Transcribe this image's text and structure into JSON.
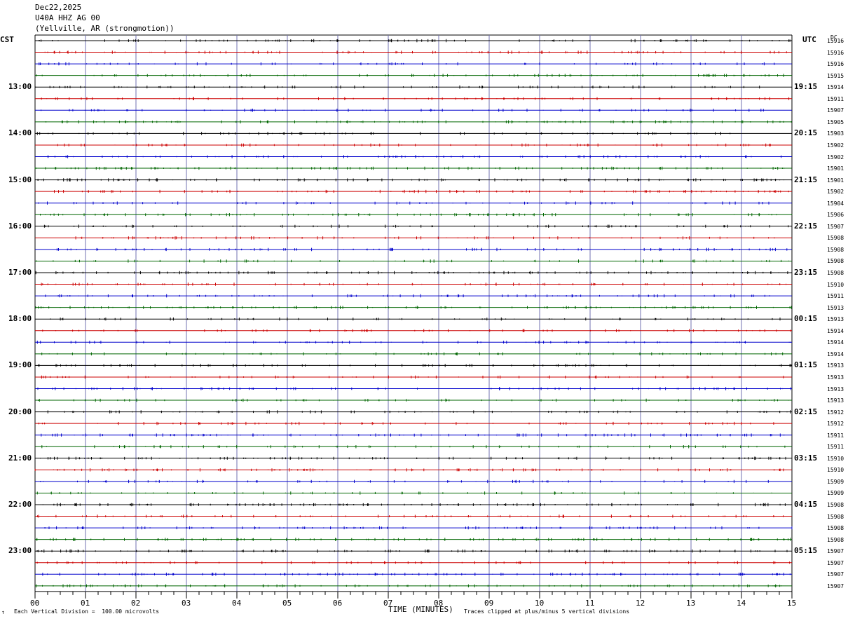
{
  "header": {
    "date": "Dec22,2025",
    "station": "U40A HHZ AG 00",
    "location": "(Yellville, AR (strongmotion))"
  },
  "left_zone": "CST",
  "right_zone": "UTC",
  "dc_label": "DC",
  "footer": {
    "vertical_division": "Each Vertical Division =  100.00 microvolts",
    "clipping": "Traces clipped at plus/minus 5 vertical divisions",
    "mark": "↑"
  },
  "chart_data": {
    "type": "line",
    "title": "",
    "xlabel": "TIME (MINUTES)",
    "ylabel": "",
    "xlim": [
      0,
      15
    ],
    "x_ticks": [
      "00",
      "01",
      "02",
      "03",
      "04",
      "05",
      "06",
      "07",
      "08",
      "09",
      "10",
      "11",
      "12",
      "13",
      "14",
      "15"
    ],
    "trace_count": 48,
    "trace_colors": [
      "#000000",
      "#cc0000",
      "#0000cc",
      "#006600"
    ],
    "left_time_labels": [
      "13:00",
      "14:00",
      "15:00",
      "16:00",
      "17:00",
      "18:00",
      "19:00",
      "20:00",
      "21:00",
      "22:00",
      "23:00"
    ],
    "right_time_labels": [
      "19:15",
      "20:15",
      "21:15",
      "22:15",
      "23:15",
      "00:15",
      "01:15",
      "02:15",
      "03:15",
      "04:15",
      "05:15"
    ],
    "dc_values": [
      "15916",
      "15916",
      "15916",
      "15915",
      "15914",
      "15911",
      "15907",
      "15905",
      "15903",
      "15902",
      "15902",
      "15901",
      "15901",
      "15902",
      "15904",
      "15906",
      "15907",
      "15908",
      "15908",
      "15908",
      "15908",
      "15910",
      "15911",
      "15913",
      "15913",
      "15914",
      "15914",
      "15914",
      "15913",
      "15913",
      "15913",
      "15913",
      "15912",
      "15912",
      "15911",
      "15911",
      "15910",
      "15910",
      "15909",
      "15909",
      "15908",
      "15908",
      "15908",
      "15908",
      "15907",
      "15907",
      "15907",
      "15907"
    ]
  }
}
